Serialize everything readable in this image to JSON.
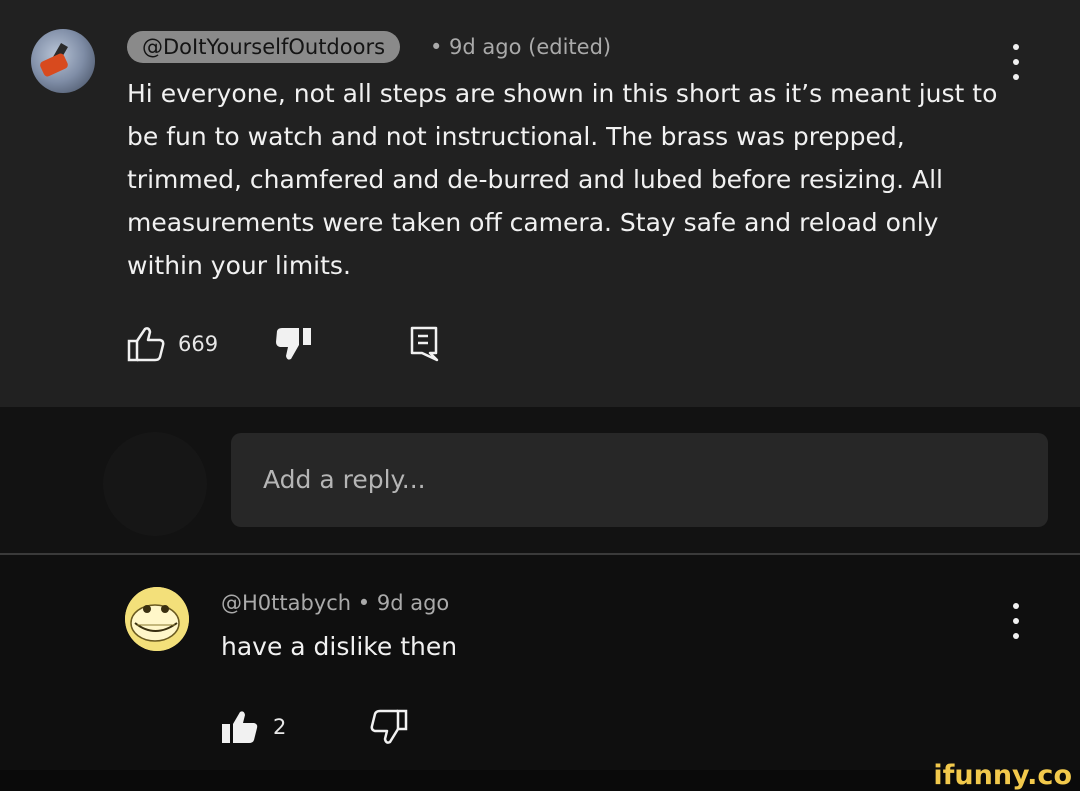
{
  "top_comment": {
    "handle": "@DoItYourselfOutdoors",
    "meta": "• 9d ago (edited)",
    "body": "Hi everyone, not all steps are shown in this short as it’s meant just to be fun to watch and not instructional. The brass was prepped, trimmed, chamfered and de-burred and lubed before resizing. All measurements were taken off camera.  Stay safe and reload only within your limits.",
    "like_count": "669"
  },
  "reply_box": {
    "placeholder": "Add a reply..."
  },
  "reply_comment": {
    "handle": "@H0ttabych",
    "meta": "• 9d ago",
    "body": "have a dislike then",
    "like_count": "2"
  },
  "watermark": "ifunny.co"
}
